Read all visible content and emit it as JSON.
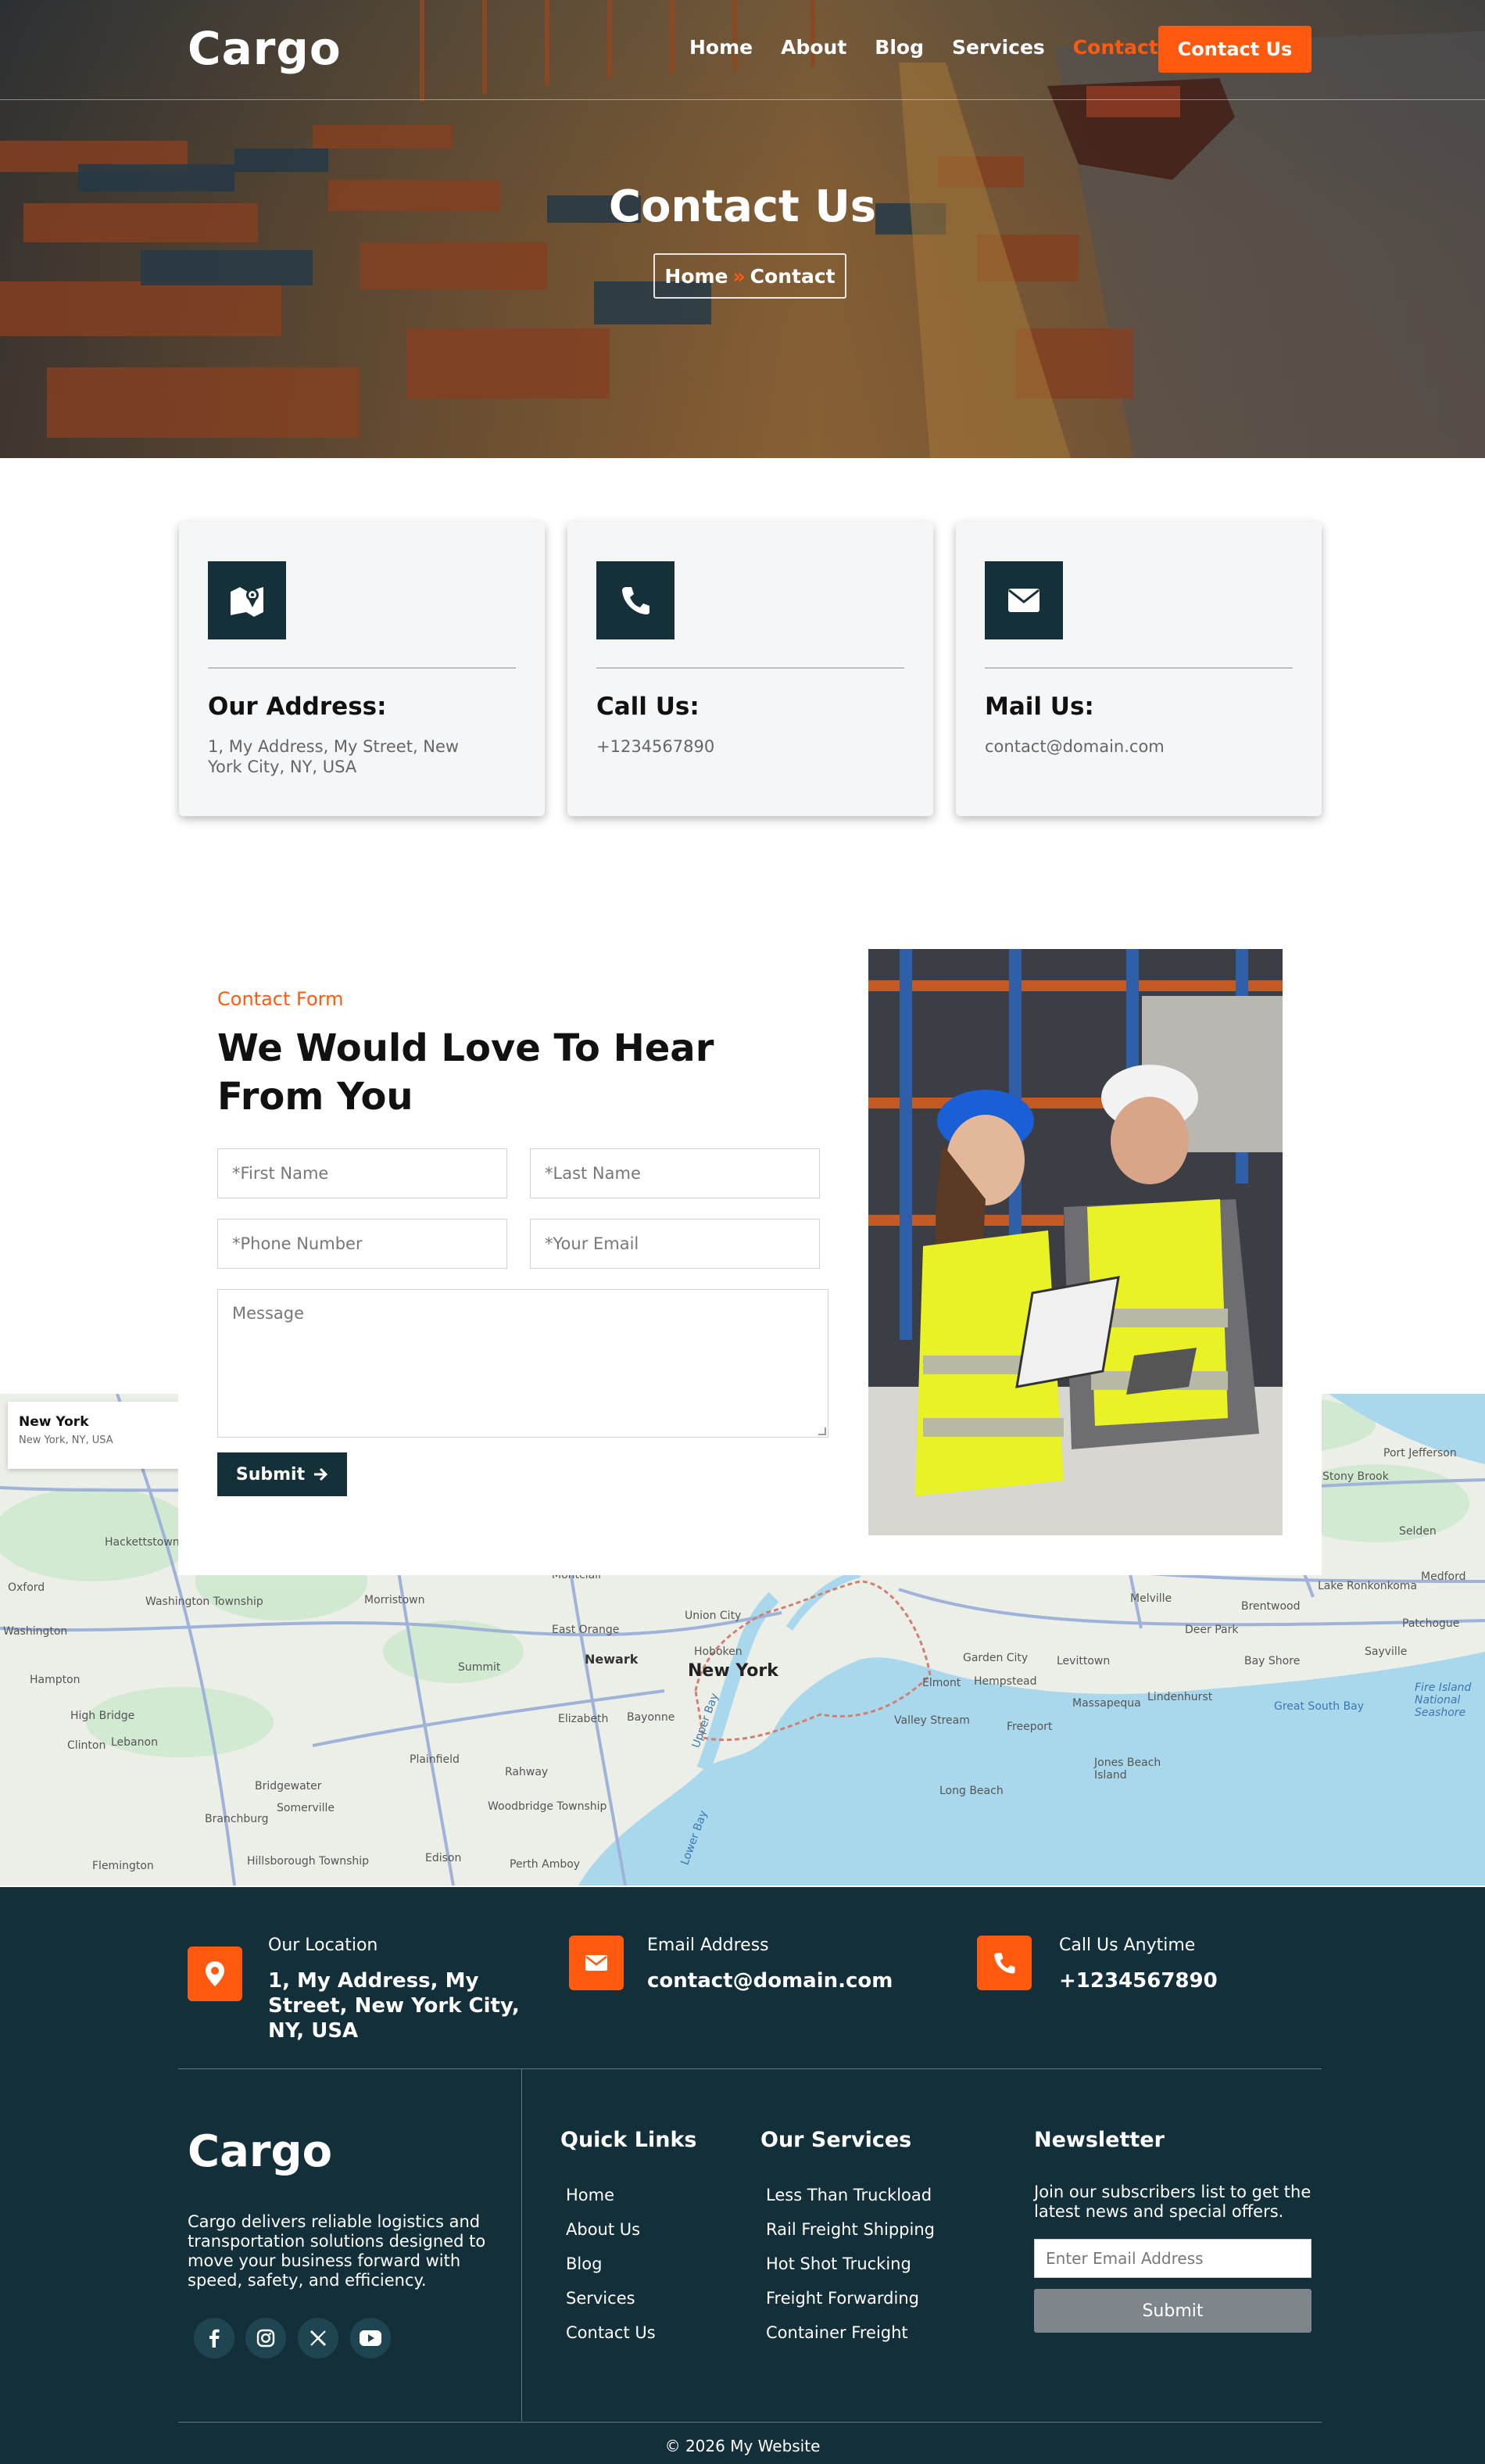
{
  "header": {
    "logo": "Cargo",
    "nav": [
      "Home",
      "About",
      "Blog",
      "Services",
      "Contact"
    ],
    "active_nav": "Contact",
    "cta_label": "Contact Us"
  },
  "hero": {
    "title": "Contact Us",
    "breadcrumb_home": "Home",
    "breadcrumb_sep": "»",
    "breadcrumb_current": "Contact"
  },
  "info_cards": [
    {
      "icon": "map-icon",
      "title": "Our Address:",
      "text": "1, My Address, My Street, New York City, NY, USA"
    },
    {
      "icon": "phone-icon",
      "title": "Call Us:",
      "text": "+1234567890"
    },
    {
      "icon": "envelope-icon",
      "title": "Mail Us:",
      "text": "contact@domain.com"
    }
  ],
  "contact_form": {
    "eyebrow": "Contact Form",
    "heading": "We Would Love To Hear From You",
    "first_name_placeholder": "*First Name",
    "last_name_placeholder": "*Last Name",
    "phone_placeholder": "*Phone Number",
    "email_placeholder": "*Your Email",
    "message_placeholder": "Message",
    "submit_label": "Submit"
  },
  "map": {
    "popup_title": "New York",
    "popup_subtitle": "New York, NY, USA",
    "labels": {
      "new_york": "New York",
      "newark": "Newark",
      "hoboken": "Hoboken",
      "union_city": "Union City",
      "east_orange": "East Orange",
      "montclair": "Montclair",
      "morristown": "Morristown",
      "summit": "Summit",
      "elizabeth": "Elizabeth",
      "bayonne": "Bayonne",
      "rahway": "Rahway",
      "plainfield": "Plainfield",
      "woodbridge": "Woodbridge Township",
      "perth_amboy": "Perth Amboy",
      "edison": "Edison",
      "somerville": "Somerville",
      "bridgewater": "Bridgewater",
      "branchburg": "Branchburg",
      "hillsborough": "Hillsborough Township",
      "flemington": "Flemington",
      "clinton": "Clinton",
      "lebanon": "Lebanon",
      "high_bridge": "High Bridge",
      "hampton": "Hampton",
      "oxford": "Oxford",
      "hackettstown": "Hackettstown",
      "washington": "Washington",
      "washington_township": "Washington Township",
      "garden_city": "Garden City",
      "hempstead": "Hempstead",
      "levittown": "Levittown",
      "elmont": "Elmont",
      "valley_stream": "Valley Stream",
      "freeport": "Freeport",
      "massapequa": "Massapequa",
      "lindenhurst": "Lindenhurst",
      "long_beach": "Long Beach",
      "jones_beach": "Jones Beach Island",
      "deer_park": "Deer Park",
      "bay_shore": "Bay Shore",
      "brentwood": "Brentwood",
      "melville": "Melville",
      "sayville": "Sayville",
      "patchogue": "Patchogue",
      "ronkonkoma": "Lake Ronkonkoma",
      "medford": "Medford",
      "selden": "Selden",
      "stony_brook": "Stony Brook",
      "port_jefferson": "Port Jefferson",
      "great_south_bay": "Great South Bay",
      "fire_island": "Fire Island National Seashore",
      "lower_bay": "Lower Bay",
      "upper_bay": "Upper Bay"
    }
  },
  "footer": {
    "location_label": "Our Location",
    "location_value": "1, My Address, My Street, New York City, NY, USA",
    "email_label": "Email Address",
    "email_value": "contact@domain.com",
    "phone_label": "Call Us Anytime",
    "phone_value": "+1234567890",
    "logo": "Cargo",
    "about": "Cargo delivers reliable logistics and transportation solutions designed to move your business forward with speed, safety, and efficiency.",
    "social_icons": [
      "facebook-icon",
      "instagram-icon",
      "x-icon",
      "youtube-icon"
    ],
    "quick_links_title": "Quick Links",
    "quick_links": [
      "Home",
      "About Us",
      "Blog",
      "Services",
      "Contact Us"
    ],
    "services_title": "Our Services",
    "services": [
      "Less Than Truckload",
      "Rail Freight Shipping",
      "Hot Shot Trucking",
      "Freight Forwarding",
      "Container Freight"
    ],
    "newsletter_title": "Newsletter",
    "newsletter_text": "Join our subscribers list to get the latest news and special offers.",
    "newsletter_placeholder": "Enter Email Address",
    "newsletter_button": "Submit",
    "copyright": "© 2026 My Website"
  },
  "colors": {
    "accent": "#ff5a0f",
    "dark": "#13303a"
  }
}
